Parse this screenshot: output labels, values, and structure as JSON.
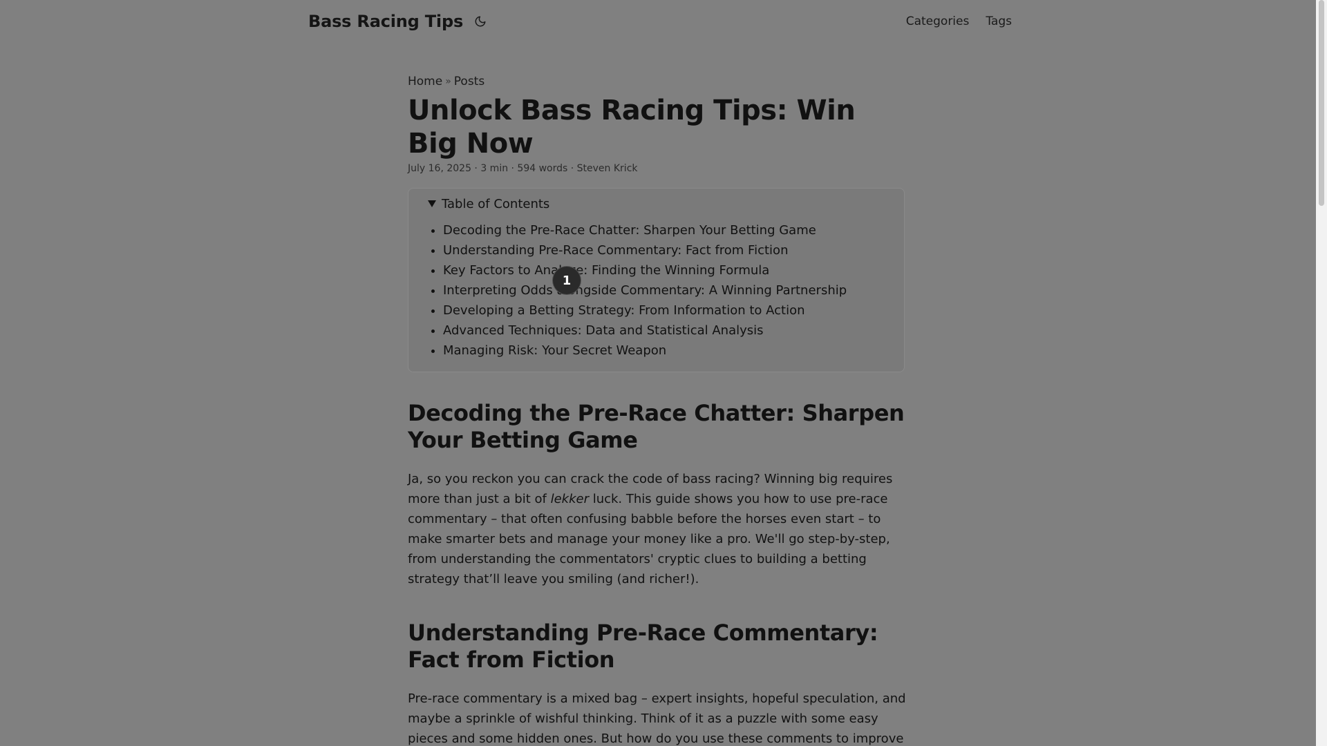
{
  "header": {
    "site_title": "Bass Racing Tips",
    "theme_toggle_icon": "moon-icon",
    "nav": [
      {
        "label": "Categories"
      },
      {
        "label": "Tags"
      }
    ]
  },
  "breadcrumb": {
    "home": "Home",
    "separator": "»",
    "posts": "Posts"
  },
  "post": {
    "title": "Unlock Bass Racing Tips: Win Big Now",
    "meta": "July 16, 2025 · 3 min · 594 words · Steven Krick"
  },
  "toc": {
    "summary": "Table of Contents",
    "items": [
      {
        "label": "Decoding the Pre-Race Chatter: Sharpen Your Betting Game"
      },
      {
        "label": "Understanding Pre-Race Commentary: Fact from Fiction"
      },
      {
        "label": "Key Factors to Analyze: Finding the Winning Formula"
      },
      {
        "label": "Interpreting Odds alongside Commentary: A Winning Partnership"
      },
      {
        "label": "Developing a Betting Strategy: From Information to Action"
      },
      {
        "label": "Advanced Techniques: Data and Statistical Analysis"
      },
      {
        "label": "Managing Risk: Your Secret Weapon"
      }
    ]
  },
  "article": {
    "section1": {
      "heading": "Decoding the Pre-Race Chatter: Sharpen Your Betting Game",
      "para_before": "Ja, so you reckon you can crack the code of bass racing? Winning big requires more than just a bit of ",
      "para_em": "lekker",
      "para_after": " luck. This guide shows you how to use pre-race commentary – that often confusing babble before the horses even start – to make smarter bets and manage your money like a pro. We'll go step-by-step, from understanding the commentators' cryptic clues to building a betting strategy that’ll leave you smiling (and richer!)."
    },
    "section2": {
      "heading": "Understanding Pre-Race Commentary: Fact from Fiction",
      "para": "Pre-race commentary is a mixed bag – expert insights, hopeful speculation, and maybe a sprinkle of wishful thinking. Think of it as a puzzle with some easy pieces and some hidden ones. But how do you use these comments to improve your betting?"
    }
  },
  "overlay": {
    "badge": "1"
  },
  "colors": {
    "background": "#808080",
    "toc_background": "#7a7a7a",
    "text": "#111111",
    "badge": "#2a2a2a"
  }
}
